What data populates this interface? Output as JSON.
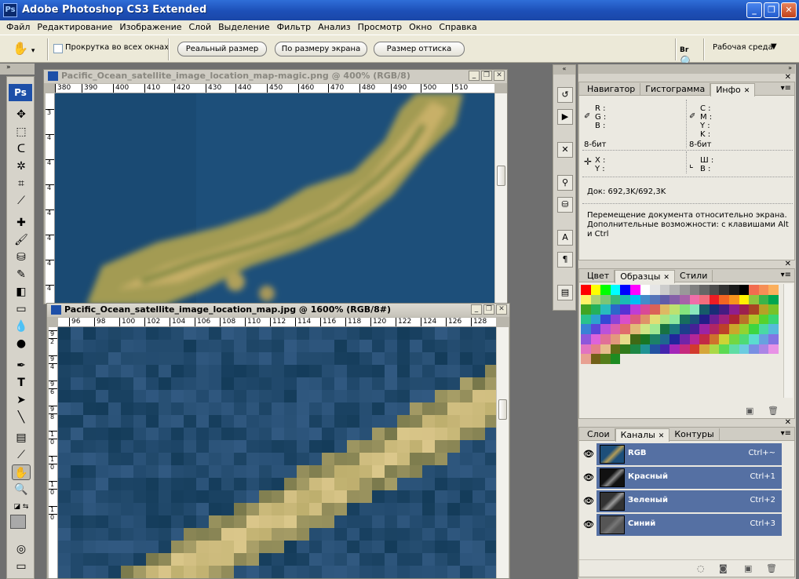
{
  "window": {
    "app_icon_text": "Ps",
    "title": "Adobe Photoshop CS3 Extended",
    "minimize": "_",
    "maximize": "❐",
    "close": "✕"
  },
  "menu": [
    "Файл",
    "Редактирование",
    "Изображение",
    "Слой",
    "Выделение",
    "Фильтр",
    "Анализ",
    "Просмотр",
    "Окно",
    "Справка"
  ],
  "options": {
    "scroll_all_windows": "Прокрутка во всех окнах",
    "actual_pixels": "Реальный размер",
    "fit_screen": "По размеру экрана",
    "print_size": "Размер оттиска",
    "workspace": "Рабочая среда",
    "bridge_icon": "Br"
  },
  "toolbox": {
    "logo": "Ps",
    "active_tool": "hand-tool"
  },
  "doc1": {
    "title": "Pacific_Ocean_satellite_image_location_map-magic.png @ 400% (RGB/8)",
    "ruler_h": [
      "380",
      "390",
      "400",
      "410",
      "420",
      "430",
      "440",
      "450",
      "460",
      "470",
      "480",
      "490",
      "500",
      "510"
    ],
    "ruler_v": [
      "3",
      "4",
      "4",
      "4",
      "4",
      "4",
      "4",
      "4"
    ]
  },
  "doc2": {
    "title": "Pacific_Ocean_satellite_image_location_map.jpg @ 1600% (RGB/8#)",
    "ruler_h": [
      "96",
      "98",
      "100",
      "102",
      "104",
      "106",
      "108",
      "110",
      "112",
      "114",
      "116",
      "118",
      "120",
      "122",
      "124",
      "126",
      "128"
    ],
    "ruler_v": [
      "9",
      "2",
      "9",
      "4",
      "9",
      "6",
      "9",
      "8",
      "1",
      "0",
      "1",
      "0",
      "1",
      "0",
      "1",
      "0"
    ]
  },
  "panels": {
    "info": {
      "tabs": [
        "Навигатор",
        "Гистограмма",
        "Инфо"
      ],
      "r": "R :",
      "g": "G :",
      "b": "B :",
      "c": "C :",
      "m": "M :",
      "y": "Y :",
      "k": "K :",
      "bits_left": "8-бит",
      "bits_right": "8-бит",
      "x": "X :",
      "y_coord": "Y :",
      "w": "Ш :",
      "h": "В :",
      "doc": "Док: 692,3K/692,3K",
      "hint": "Перемещение документа относительно экрана. Дополнительные возможности: с клавишами Alt и Ctrl"
    },
    "swatches": {
      "tabs": [
        "Цвет",
        "Образцы",
        "Стили"
      ]
    },
    "channels": {
      "tabs": [
        "Слои",
        "Каналы",
        "Контуры"
      ],
      "rows": [
        {
          "name": "RGB",
          "shortcut": "Ctrl+~"
        },
        {
          "name": "Красный",
          "shortcut": "Ctrl+1"
        },
        {
          "name": "Зеленый",
          "shortcut": "Ctrl+2"
        },
        {
          "name": "Синий",
          "shortcut": "Ctrl+3"
        }
      ]
    }
  }
}
